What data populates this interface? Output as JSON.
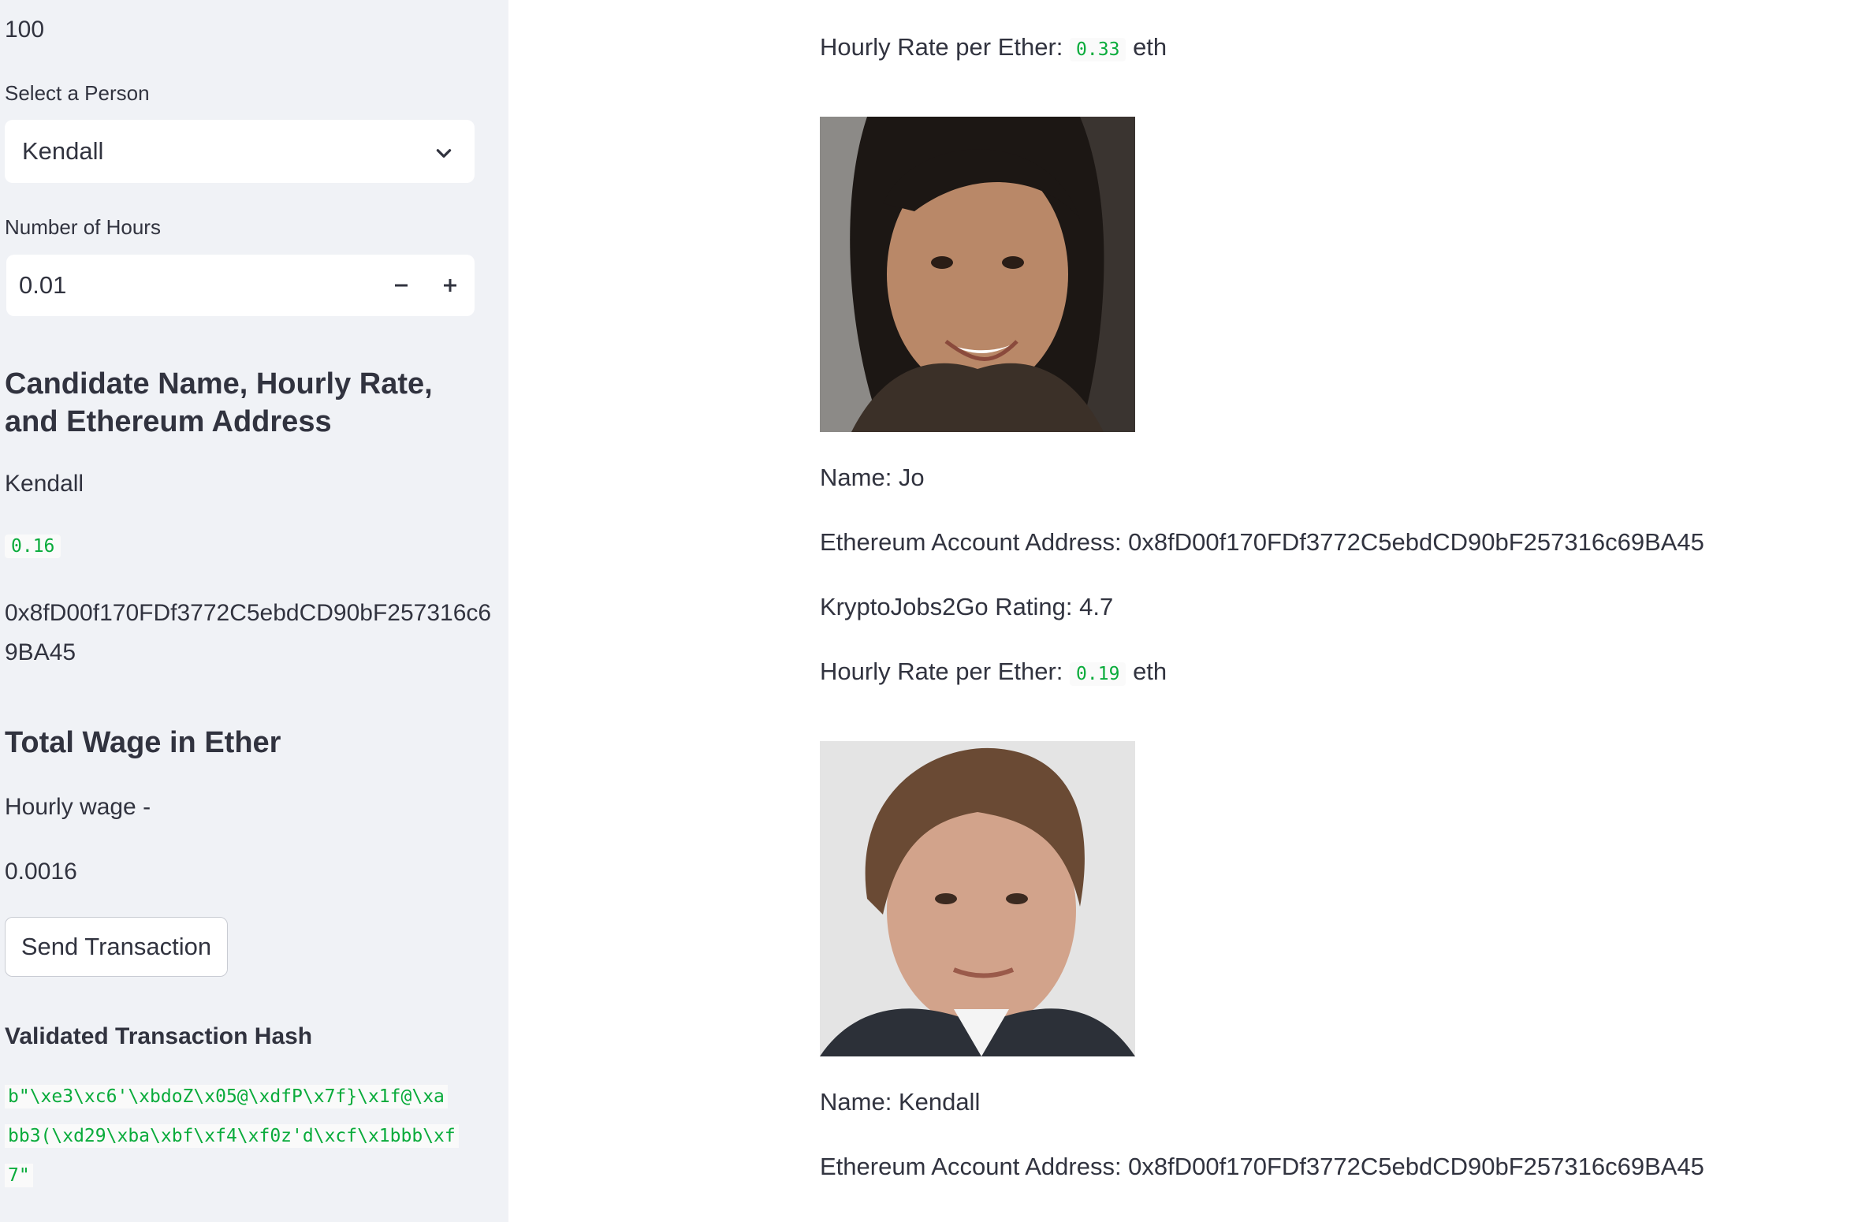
{
  "sidebar": {
    "top_value": "100",
    "select_label": "Select a Person",
    "select_value": "Kendall",
    "hours_label": "Number of Hours",
    "hours_value": "0.01",
    "heading_candidate": "Candidate Name, Hourly Rate, and Ethereum Address",
    "candidate_name": "Kendall",
    "candidate_rate": "0.16",
    "candidate_address_line1": "0x8fD00f170FDf3772C5ebdCD90bF257316c6",
    "candidate_address_line2": "9BA45",
    "heading_total": "Total Wage in Ether",
    "hourly_wage_label": "Hourly wage -",
    "hourly_wage_value": "0.0016",
    "send_button": "Send Transaction",
    "validated_heading": "Validated Transaction Hash",
    "hash_line1": "b\"\\xe3\\xc6'\\xbdoZ\\x05@\\xdfP\\x7f}\\x1f@\\xa",
    "hash_line2": "bb3(\\xd29\\xba\\xbf\\xf4\\xf0z'd\\xcf\\x1bbb\\xf",
    "hash_line3": "7\""
  },
  "main": {
    "prev_rate_label": "Hourly Rate per Ether:",
    "prev_rate_value": "0.33",
    "prev_rate_unit": "eth",
    "people": [
      {
        "name_text": "Name: Jo",
        "address_text": "Ethereum Account Address: 0x8fD00f170FDf3772C5ebdCD90bF257316c69BA45",
        "rating_text": "KryptoJobs2Go Rating: 4.7",
        "rate_label": "Hourly Rate per Ether:",
        "rate_value": "0.19",
        "rate_unit": "eth"
      },
      {
        "name_text": "Name: Kendall",
        "address_text": "Ethereum Account Address: 0x8fD00f170FDf3772C5ebdCD90bF257316c69BA45"
      }
    ]
  },
  "colors": {
    "sidebar_bg": "#f0f2f6",
    "code_green": "#09ab3b",
    "text": "#31333f"
  }
}
